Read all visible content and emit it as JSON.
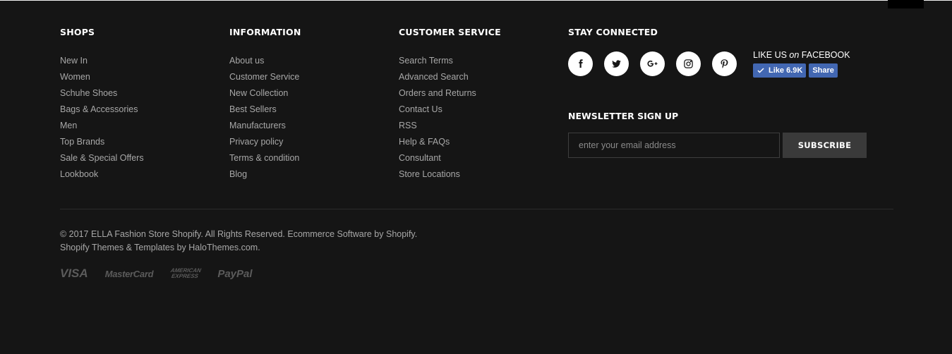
{
  "shops": {
    "title": "SHOPS",
    "items": [
      "New In",
      "Women",
      "Schuhe Shoes",
      "Bags & Accessories",
      "Men",
      "Top Brands",
      "Sale & Special Offers",
      "Lookbook"
    ]
  },
  "information": {
    "title": "INFORMATION",
    "items": [
      "About us",
      "Customer Service",
      "New Collection",
      "Best Sellers",
      "Manufacturers",
      "Privacy policy",
      "Terms & condition",
      "Blog"
    ]
  },
  "customer_service": {
    "title": "CUSTOMER SERVICE",
    "items": [
      "Search Terms",
      "Advanced Search",
      "Orders and Returns",
      "Contact Us",
      "RSS",
      "Help & FAQs",
      "Consultant",
      "Store Locations"
    ]
  },
  "stay_connected": {
    "title": "STAY CONNECTED",
    "social_icons": [
      "facebook-icon",
      "twitter-icon",
      "google-plus-icon",
      "instagram-icon",
      "pinterest-icon"
    ],
    "facebook": {
      "like_us_prefix": "LIKE US ",
      "like_us_on": "on",
      "like_us_suffix": " FACEBOOK",
      "like_label": "Like 6.9K",
      "share_label": "Share"
    }
  },
  "newsletter": {
    "title": "NEWSLETTER SIGN UP",
    "placeholder": "enter your email address",
    "button_label": "SUBSCRIBE"
  },
  "copyright": {
    "line1": "© 2017 ELLA Fashion Store Shopify. All Rights Reserved. Ecommerce Software by Shopify.",
    "line2": "Shopify Themes & Templates by HaloThemes.com."
  },
  "payments": {
    "visa": "VISA",
    "mastercard": "MasterCard",
    "amex_line1": "AMERICAN",
    "amex_line2": "EXPRESS",
    "paypal": "PayPal"
  },
  "colors": {
    "background": "#151515",
    "link": "#a8a8a8",
    "heading": "#ffffff",
    "facebook": "#4267b2"
  }
}
